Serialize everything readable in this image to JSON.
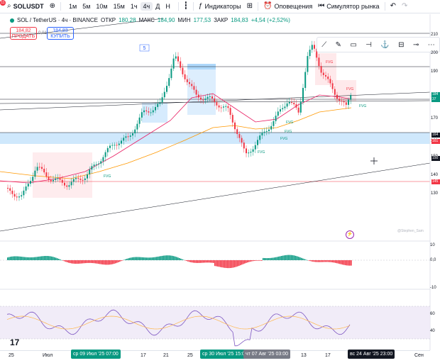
{
  "toolbar": {
    "notif_count": "11",
    "symbol": "SOLUSDT",
    "timeframes": [
      "1м",
      "5м",
      "10м",
      "15м",
      "1ч",
      "4ч",
      "Д",
      "Н"
    ],
    "active_timeframe": "4ч",
    "indicators_label": "Индикаторы",
    "alerts_label": "Оповещения",
    "replay_label": "Симулятор рынка"
  },
  "legend": {
    "title": "SOL / TetherUS · 4ч · BINANCE",
    "open_label": "ОТКР",
    "open": "180,28",
    "high_label": "МАКС",
    "high": "184,90",
    "low_label": "МИН",
    "low": "177,53",
    "close_label": "ЗАКР",
    "close": "184,83",
    "change": "+4,54 (+2,52%)"
  },
  "trade": {
    "sell_price": "184,82",
    "sell_label": "ПРОДАТЬ",
    "spread": "0,01",
    "buy_price": "184,83",
    "buy_label": "КУПИТЬ"
  },
  "annotation_number": "5",
  "fvg_label": "FVG",
  "watermark": "@Stephen_Sam",
  "price_axis": [
    "210",
    "200",
    "190",
    "180",
    "170",
    "160",
    "150",
    "140",
    "130"
  ],
  "price_tags": [
    {
      "text": "184",
      "color": "#089981"
    },
    {
      "text": "37",
      "color": "#089981"
    },
    {
      "text": "164",
      "color": "#131722"
    },
    {
      "text": "161",
      "color": "#f23645"
    },
    {
      "text": "150",
      "color": "#131722"
    },
    {
      "text": "145",
      "color": "#f23645"
    }
  ],
  "macd_axis": [
    "10",
    "0,0",
    "-10"
  ],
  "rsi_axis": [
    "60",
    "40"
  ],
  "time_axis": [
    "25",
    "Июл",
    "17",
    "21",
    "25",
    "13",
    "17",
    "Сен"
  ],
  "time_labels": [
    {
      "text": "ср 09 Июл '25  07:00",
      "color": "#089981"
    },
    {
      "text": "ср 30 Июл '25  15:00",
      "color": "#089981"
    },
    {
      "text": "чт 07 Авг '25  03:00",
      "color": "#787b86"
    },
    {
      "text": "вс 24 Авг '25  23:00",
      "color": "#131722"
    }
  ],
  "colors": {
    "up": "#089981",
    "down": "#f23645",
    "ma_fast": "#e91e63",
    "ma_slow": "#ff9800",
    "rsi": "#7e57c2",
    "rsi_band": "#ede7f6",
    "zone_blue": "#bbdefb",
    "zone_red": "#fde0e3"
  },
  "icons": [
    "plus-circle-icon",
    "indicators-icon",
    "alarm-clock-icon",
    "replay-icon",
    "undo-icon",
    "redo-icon",
    "tradingview-logo-icon",
    "lightning-icon"
  ]
}
